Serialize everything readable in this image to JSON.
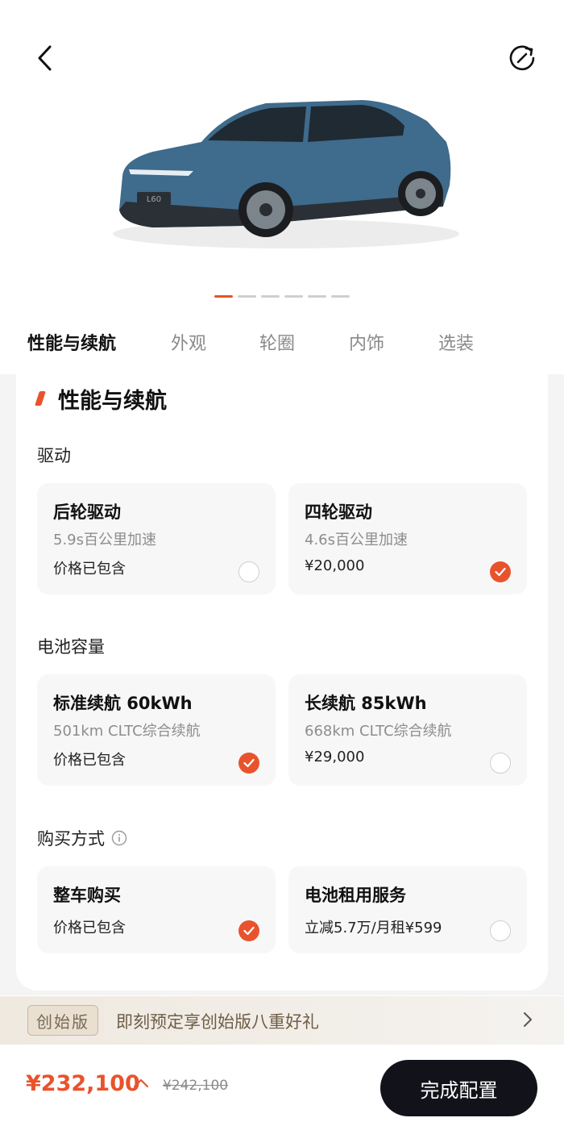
{
  "header": {
    "back_icon": "chevron-left-icon",
    "reset_icon": "refresh-icon"
  },
  "car_image": {
    "plate_text": "L60",
    "body_color": "#3f6b8c"
  },
  "carousel": {
    "count": 6,
    "active_index": 0
  },
  "tabs": [
    {
      "label": "性能与续航",
      "active": true
    },
    {
      "label": "外观",
      "active": false
    },
    {
      "label": "轮圈",
      "active": false
    },
    {
      "label": "内饰",
      "active": false
    },
    {
      "label": "选装",
      "active": false
    }
  ],
  "section": {
    "title": "性能与续航"
  },
  "drive": {
    "label": "驱动",
    "options": [
      {
        "title": "后轮驱动",
        "subtitle": "5.9s百公里加速",
        "price": "价格已包含",
        "selected": false
      },
      {
        "title": "四轮驱动",
        "subtitle": "4.6s百公里加速",
        "price": "¥20,000",
        "selected": true
      }
    ]
  },
  "battery": {
    "label": "电池容量",
    "options": [
      {
        "title": "标准续航 60kWh",
        "subtitle": "501km CLTC综合续航",
        "price": "价格已包含",
        "selected": true
      },
      {
        "title": "长续航 85kWh",
        "subtitle": "668km CLTC综合续航",
        "price": "¥29,000",
        "selected": false
      }
    ]
  },
  "purchase": {
    "label": "购买方式",
    "info_icon": "info-icon",
    "options": [
      {
        "title": "整车购买",
        "price": "价格已包含",
        "selected": true
      },
      {
        "title": "电池租用服务",
        "price": "立减5.7万/月租¥599",
        "selected": false
      }
    ]
  },
  "promo": {
    "badge": "创始版",
    "text": "即刻预定享创始版八重好礼"
  },
  "footer": {
    "price": "¥232,100",
    "original_price": "¥242,100",
    "button": "完成配置"
  },
  "colors": {
    "accent": "#e8532d",
    "button_dark": "#12131a"
  }
}
